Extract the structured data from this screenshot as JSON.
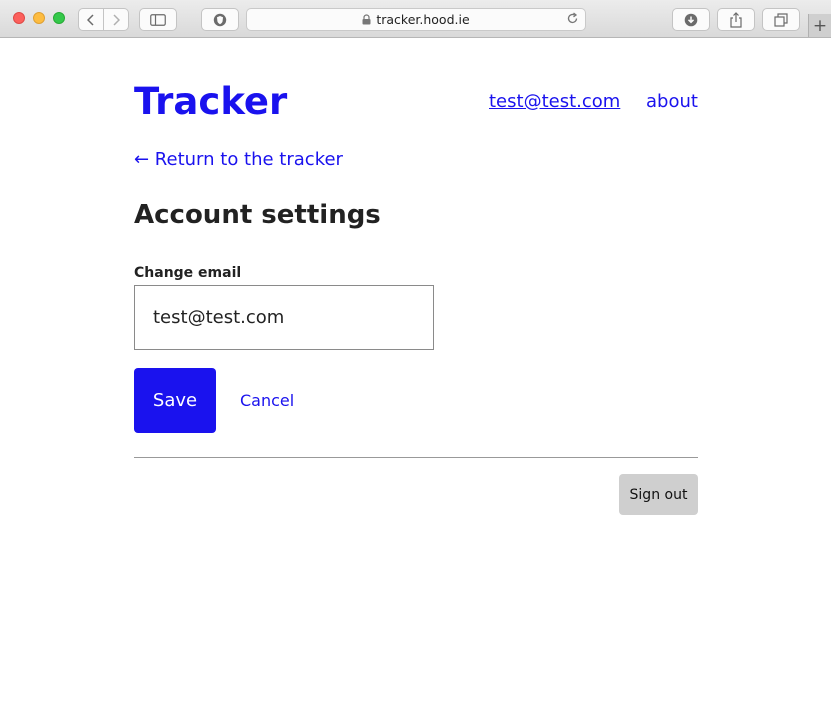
{
  "browser": {
    "url": "tracker.hood.ie",
    "new_tab_label": "+"
  },
  "header": {
    "brand": "Tracker",
    "user_email": "test@test.com",
    "about_label": "about"
  },
  "back_link": "← Return to the tracker",
  "page_title": "Account settings",
  "form": {
    "email_label": "Change email",
    "email_value": "test@test.com",
    "save_label": "Save",
    "cancel_label": "Cancel"
  },
  "signout_label": "Sign out",
  "colors": {
    "accent": "#1a12ee",
    "text": "#222222",
    "signout_bg": "#cfcfcf"
  },
  "icons": {
    "back": "chevron-left-icon",
    "forward": "chevron-right-icon",
    "sidebar": "sidebar-icon",
    "shield": "shield-icon",
    "lock": "lock-icon",
    "reload": "reload-icon",
    "download": "download-icon",
    "share": "share-icon",
    "tabs": "tabs-icon"
  }
}
